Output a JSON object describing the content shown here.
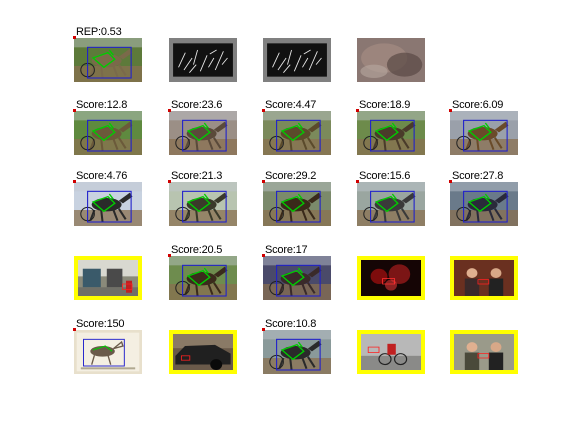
{
  "figure": {
    "rows": [
      {
        "cells": [
          {
            "label": "REP:0.53",
            "kind": "race",
            "highlight": false,
            "tint": "#7a6a4a",
            "bg": "#5d7a3a"
          },
          {
            "label": "",
            "kind": "edges",
            "highlight": false,
            "tint": "#222222",
            "bg": "#222222"
          },
          {
            "label": "",
            "kind": "edges",
            "highlight": false,
            "tint": "#222222",
            "bg": "#222222"
          },
          {
            "label": "",
            "kind": "blur",
            "highlight": false,
            "tint": "#7a6a66",
            "bg": "#8a7772"
          },
          {
            "label": "",
            "kind": "empty",
            "highlight": false,
            "tint": "#ffffff",
            "bg": "#ffffff"
          }
        ]
      },
      {
        "cells": [
          {
            "label": "Score:12.8",
            "kind": "race",
            "highlight": false,
            "tint": "#6b5a3a",
            "bg": "#5f8a3f"
          },
          {
            "label": "Score:23.6",
            "kind": "race",
            "highlight": false,
            "tint": "#5a4a3a",
            "bg": "#9b8f86"
          },
          {
            "label": "Score:4.47",
            "kind": "race",
            "highlight": false,
            "tint": "#5b4b2b",
            "bg": "#7b8a5b"
          },
          {
            "label": "Score:18.9",
            "kind": "race",
            "highlight": false,
            "tint": "#4a3b2a",
            "bg": "#6d8b4b"
          },
          {
            "label": "Score:6.09",
            "kind": "race",
            "highlight": false,
            "tint": "#6a4b2a",
            "bg": "#9aa0aa"
          }
        ]
      },
      {
        "cells": [
          {
            "label": "Score:4.76",
            "kind": "race",
            "highlight": false,
            "tint": "#2a2a2a",
            "bg": "#c8d2e0"
          },
          {
            "label": "Score:21.3",
            "kind": "race",
            "highlight": false,
            "tint": "#3a3a2a",
            "bg": "#b8c4b0"
          },
          {
            "label": "Score:29.2",
            "kind": "race",
            "highlight": false,
            "tint": "#3a2a1a",
            "bg": "#7b8a6b"
          },
          {
            "label": "Score:15.6",
            "kind": "race",
            "highlight": false,
            "tint": "#3a3a3a",
            "bg": "#9aa6a0"
          },
          {
            "label": "Score:27.8",
            "kind": "race",
            "highlight": false,
            "tint": "#2a2a3a",
            "bg": "#6a7a8a"
          }
        ]
      },
      {
        "cells": [
          {
            "label": "",
            "kind": "street",
            "highlight": true,
            "tint": "#5a5a5a",
            "bg": "#8a8a7a"
          },
          {
            "label": "Score:20.5",
            "kind": "race",
            "highlight": false,
            "tint": "#3b2b1b",
            "bg": "#6e8c4e"
          },
          {
            "label": "Score:17",
            "kind": "race",
            "highlight": false,
            "tint": "#3a2a2a",
            "bg": "#4a4a6a"
          },
          {
            "label": "",
            "kind": "night",
            "highlight": true,
            "tint": "#aa1010",
            "bg": "#150505"
          },
          {
            "label": "",
            "kind": "people",
            "highlight": true,
            "tint": "#3a2a2a",
            "bg": "#6a3020"
          }
        ]
      },
      {
        "cells": [
          {
            "label": "Score:150",
            "kind": "sketch",
            "highlight": false,
            "tint": "#8a7a5a",
            "bg": "#e8e0cc"
          },
          {
            "label": "",
            "kind": "car",
            "highlight": true,
            "tint": "#202020",
            "bg": "#6a5a4a"
          },
          {
            "label": "Score:10.8",
            "kind": "race",
            "highlight": false,
            "tint": "#2a2a2a",
            "bg": "#8a9a9a"
          },
          {
            "label": "",
            "kind": "cycle",
            "highlight": true,
            "tint": "#555555",
            "bg": "#b8b8b8"
          },
          {
            "label": "",
            "kind": "people",
            "highlight": true,
            "tint": "#4a4a3a",
            "bg": "#9a9a8a"
          }
        ]
      }
    ]
  }
}
